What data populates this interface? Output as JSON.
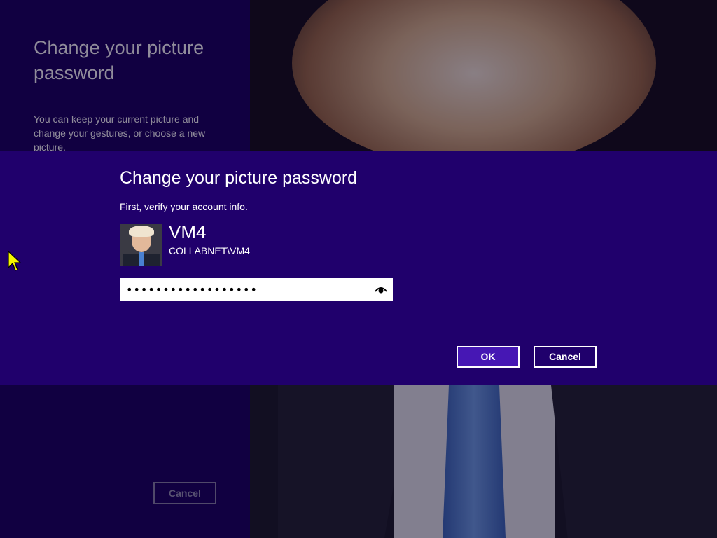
{
  "background": {
    "title": "Change your picture password",
    "description": "You can keep your current picture and change your gestures, or choose a new picture.",
    "cancel_label": "Cancel"
  },
  "dialog": {
    "title": "Change your picture password",
    "subtitle": "First, verify your account info.",
    "user": {
      "name": "VM4",
      "account": "COLLABNET\\VM4"
    },
    "password": {
      "value": "••••••••••••••••••",
      "reveal_icon": "eye-icon"
    },
    "ok_label": "OK",
    "cancel_label": "Cancel"
  },
  "colors": {
    "dialog_bg": "#20006c",
    "left_panel_bg": "#18005e",
    "ok_button_bg": "#4617b4"
  }
}
